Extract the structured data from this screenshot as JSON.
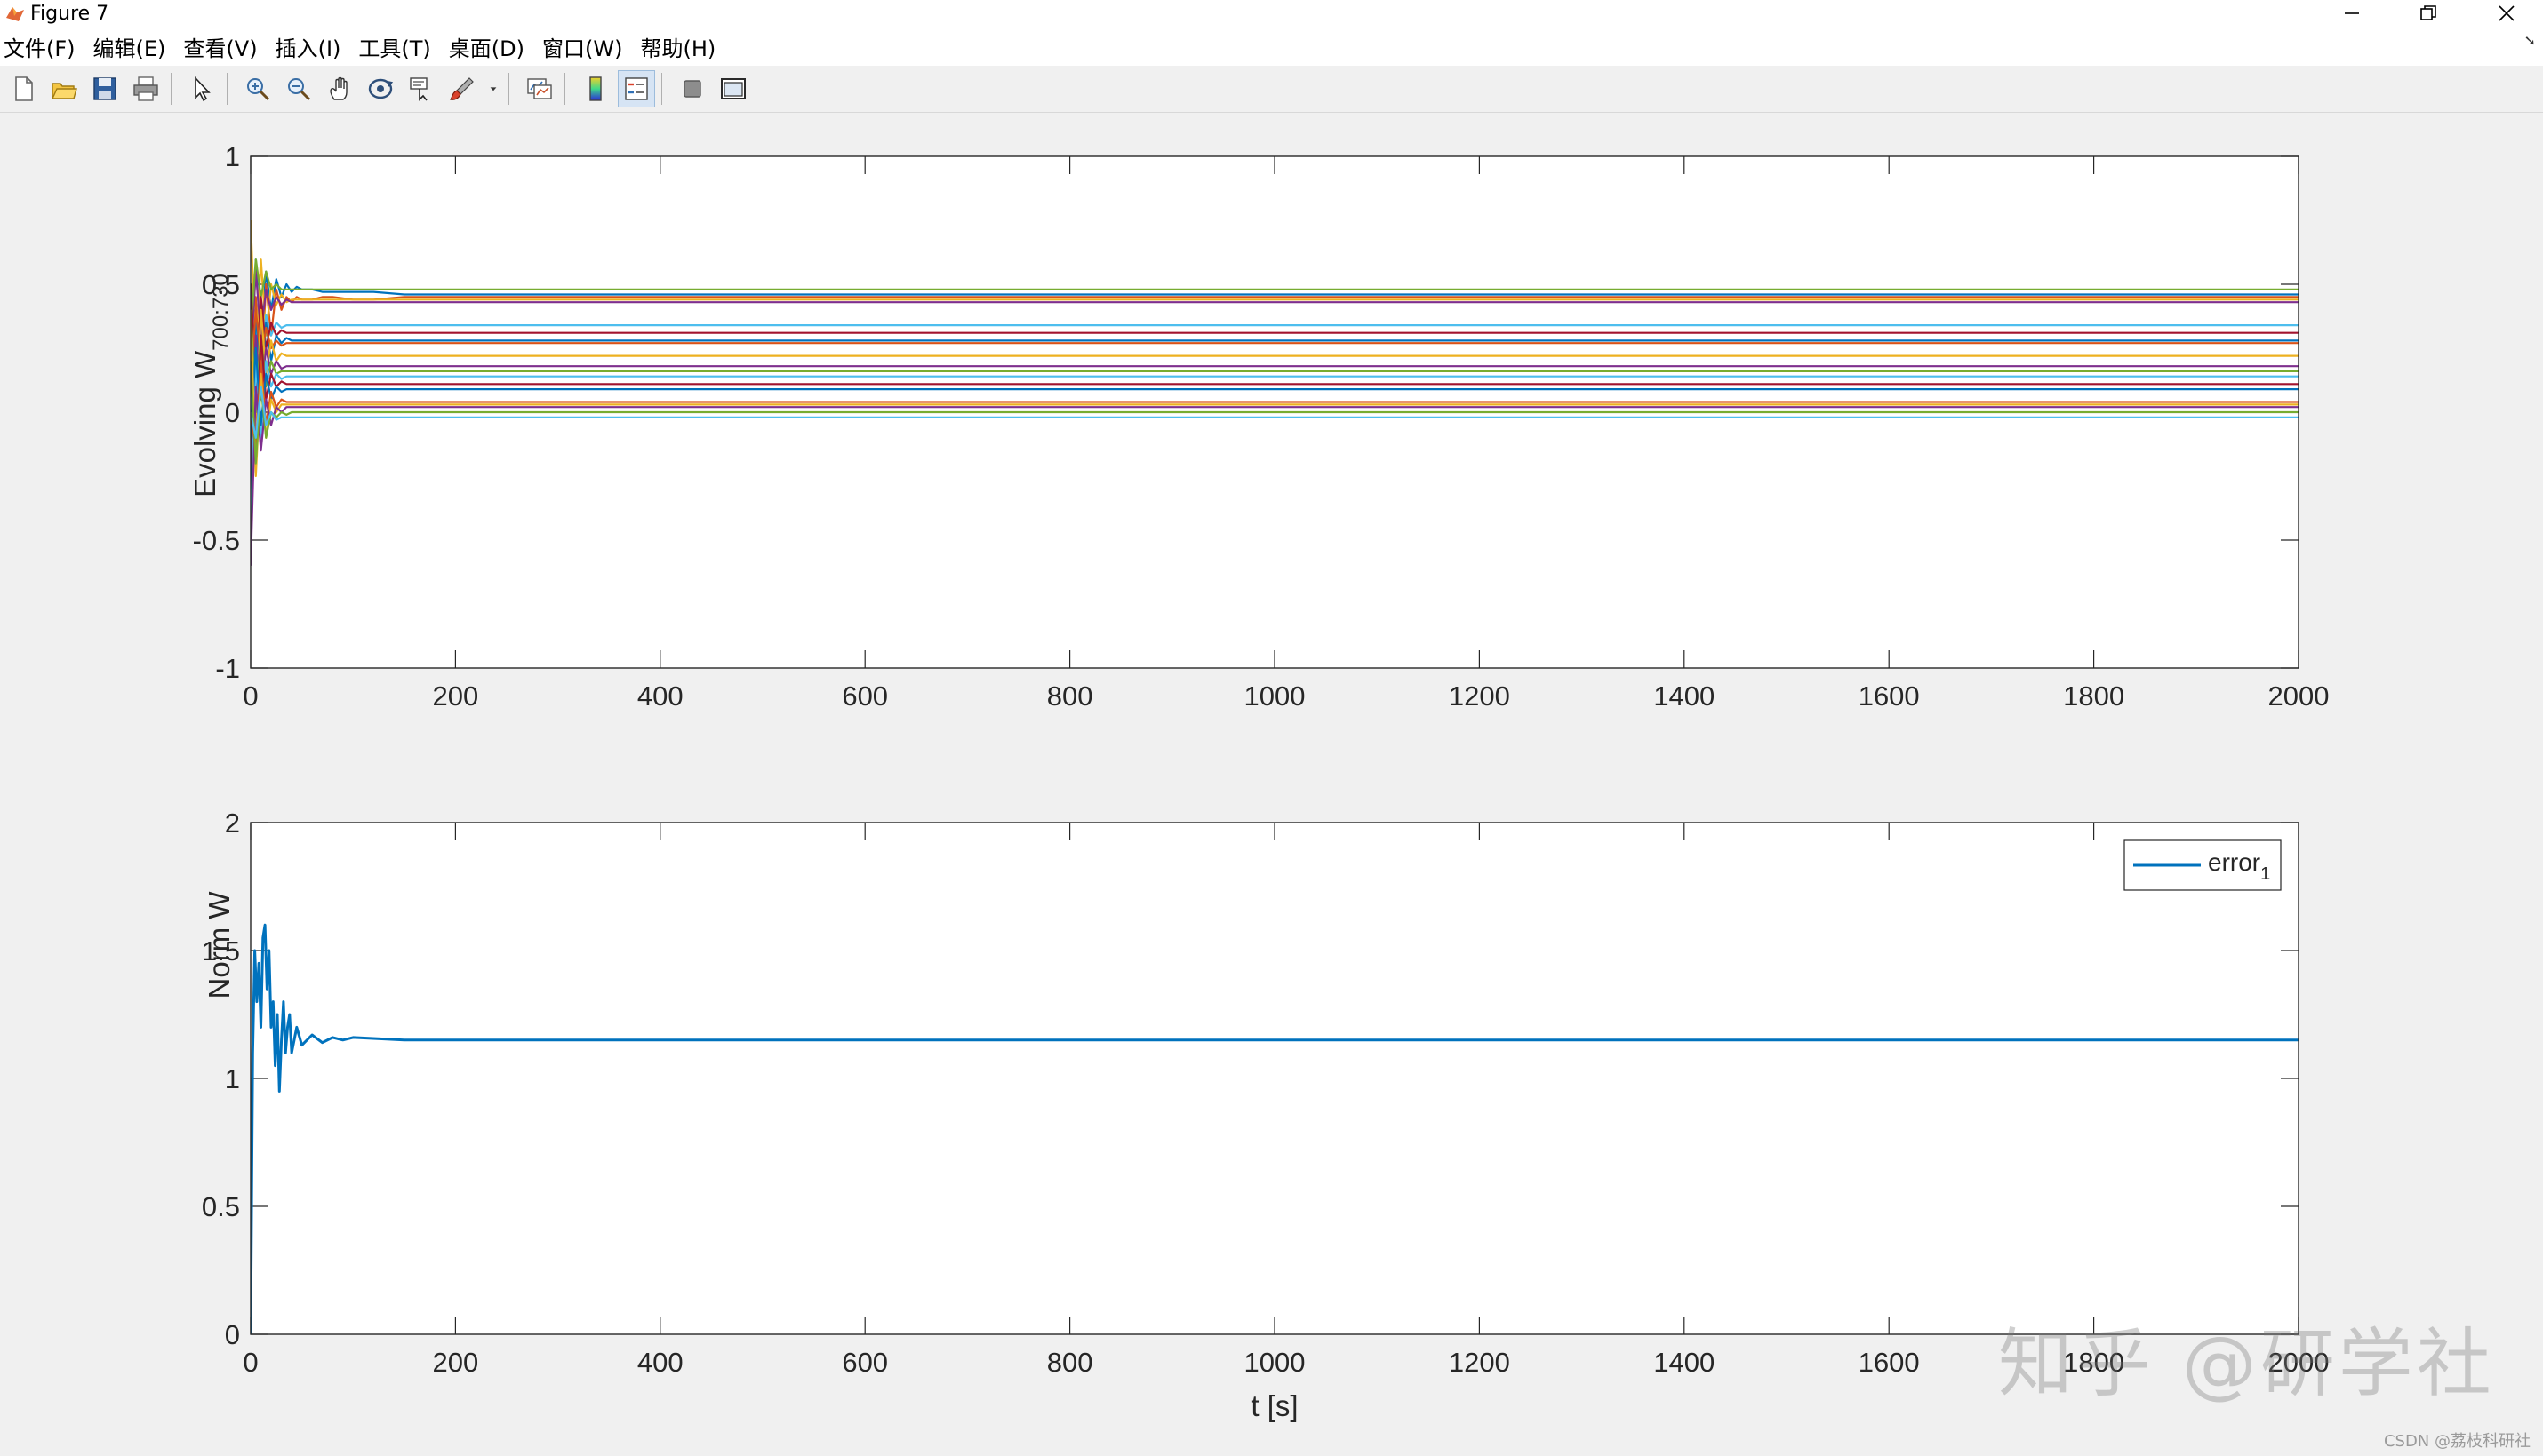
{
  "window": {
    "title": "Figure 7",
    "controls": {
      "minimize": "minimize",
      "maximize": "restore",
      "close": "close"
    }
  },
  "menu": [
    {
      "label": "文件(F)"
    },
    {
      "label": "编辑(E)"
    },
    {
      "label": "查看(V)"
    },
    {
      "label": "插入(I)"
    },
    {
      "label": "工具(T)"
    },
    {
      "label": "桌面(D)"
    },
    {
      "label": "窗口(W)"
    },
    {
      "label": "帮助(H)"
    }
  ],
  "toolbar": [
    {
      "icon": "new-figure-icon"
    },
    {
      "icon": "open-file-icon"
    },
    {
      "icon": "save-icon"
    },
    {
      "icon": "print-icon"
    },
    {
      "sep": true
    },
    {
      "icon": "pointer-icon"
    },
    {
      "sep": true
    },
    {
      "icon": "zoom-in-icon"
    },
    {
      "icon": "zoom-out-icon"
    },
    {
      "icon": "pan-icon"
    },
    {
      "icon": "rotate-3d-icon"
    },
    {
      "icon": "data-cursor-icon"
    },
    {
      "icon": "brush-icon"
    },
    {
      "icon": "dropdown-icon"
    },
    {
      "sep": true
    },
    {
      "icon": "link-plot-icon"
    },
    {
      "sep": true
    },
    {
      "icon": "colorbar-icon"
    },
    {
      "icon": "legend-icon",
      "pressed": true
    },
    {
      "sep": true
    },
    {
      "icon": "hide-plot-tools-icon"
    },
    {
      "icon": "show-plot-tools-icon"
    }
  ],
  "colors": {
    "matlab_order": [
      "#0072BD",
      "#D95319",
      "#EDB120",
      "#7E2F8E",
      "#77AC30",
      "#4DBEEE",
      "#A2142F"
    ]
  },
  "chart_data": [
    {
      "type": "line",
      "ylabel_main": "Evolving W",
      "ylabel_sub": "700:730",
      "xlabel": "",
      "xlim": [
        0,
        2000
      ],
      "ylim": [
        -1,
        1
      ],
      "xticks": [
        "0",
        "200",
        "400",
        "600",
        "800",
        "1000",
        "1200",
        "1400",
        "1600",
        "1800",
        "2000"
      ],
      "yticks": [
        "-1",
        "-0.5",
        "0",
        "0.5",
        "1"
      ],
      "x": [
        0,
        5,
        10,
        15,
        20,
        25,
        30,
        35,
        40,
        45,
        50,
        60,
        70,
        80,
        100,
        120,
        150,
        200,
        300,
        500,
        1000,
        2000
      ],
      "series": [
        {
          "values": [
            0.1,
            0.6,
            0.25,
            0.55,
            0.4,
            0.52,
            0.45,
            0.5,
            0.47,
            0.49,
            0.48,
            0.48,
            0.47,
            0.47,
            0.47,
            0.47,
            0.46,
            0.46,
            0.46,
            0.46,
            0.46,
            0.46
          ]
        },
        {
          "values": [
            -0.1,
            0.45,
            0.1,
            0.5,
            0.3,
            0.48,
            0.4,
            0.45,
            0.43,
            0.45,
            0.44,
            0.44,
            0.45,
            0.45,
            0.44,
            0.44,
            0.45,
            0.45,
            0.45,
            0.45,
            0.45,
            0.45
          ]
        },
        {
          "values": [
            0.75,
            0.2,
            0.6,
            0.3,
            0.5,
            0.42,
            0.46,
            0.43,
            0.44,
            0.44,
            0.44,
            0.44,
            0.44,
            0.44,
            0.44,
            0.44,
            0.44,
            0.44,
            0.44,
            0.44,
            0.44,
            0.44
          ]
        },
        {
          "values": [
            0.2,
            0.55,
            0.3,
            0.48,
            0.4,
            0.45,
            0.42,
            0.44,
            0.43,
            0.43,
            0.43,
            0.43,
            0.43,
            0.43,
            0.43,
            0.43,
            0.43,
            0.43,
            0.43,
            0.43,
            0.43,
            0.43
          ]
        },
        {
          "values": [
            0.3,
            0.6,
            0.45,
            0.55,
            0.48,
            0.5,
            0.48,
            0.48,
            0.48,
            0.48,
            0.48,
            0.48,
            0.48,
            0.48,
            0.48,
            0.48,
            0.48,
            0.48,
            0.48,
            0.48,
            0.48,
            0.48
          ]
        },
        {
          "values": [
            0.0,
            0.35,
            0.15,
            0.38,
            0.3,
            0.35,
            0.33,
            0.34,
            0.34,
            0.34,
            0.34,
            0.34,
            0.34,
            0.34,
            0.34,
            0.34,
            0.34,
            0.34,
            0.34,
            0.34,
            0.34,
            0.34
          ]
        },
        {
          "values": [
            0.5,
            0.1,
            0.45,
            0.25,
            0.35,
            0.3,
            0.32,
            0.31,
            0.31,
            0.31,
            0.31,
            0.31,
            0.31,
            0.31,
            0.31,
            0.31,
            0.31,
            0.31,
            0.31,
            0.31,
            0.31,
            0.31
          ]
        },
        {
          "values": [
            -0.3,
            0.4,
            0.1,
            0.35,
            0.2,
            0.3,
            0.27,
            0.29,
            0.28,
            0.28,
            0.28,
            0.28,
            0.28,
            0.28,
            0.28,
            0.28,
            0.28,
            0.28,
            0.28,
            0.28,
            0.28,
            0.28
          ]
        },
        {
          "values": [
            0.1,
            0.4,
            0.2,
            0.33,
            0.25,
            0.28,
            0.26,
            0.27,
            0.27,
            0.27,
            0.27,
            0.27,
            0.27,
            0.27,
            0.27,
            0.27,
            0.27,
            0.27,
            0.27,
            0.27,
            0.27,
            0.27
          ]
        },
        {
          "values": [
            0.3,
            -0.1,
            0.4,
            0.15,
            0.28,
            0.2,
            0.23,
            0.22,
            0.22,
            0.22,
            0.22,
            0.22,
            0.22,
            0.22,
            0.22,
            0.22,
            0.22,
            0.22,
            0.22,
            0.22,
            0.22,
            0.22
          ]
        },
        {
          "values": [
            -0.2,
            0.3,
            0.05,
            0.25,
            0.15,
            0.2,
            0.17,
            0.18,
            0.18,
            0.18,
            0.18,
            0.18,
            0.18,
            0.18,
            0.18,
            0.18,
            0.18,
            0.18,
            0.18,
            0.18,
            0.18,
            0.18
          ]
        },
        {
          "values": [
            0.4,
            0.0,
            0.3,
            0.1,
            0.2,
            0.15,
            0.16,
            0.16,
            0.16,
            0.16,
            0.16,
            0.16,
            0.16,
            0.16,
            0.16,
            0.16,
            0.16,
            0.16,
            0.16,
            0.16,
            0.16,
            0.16
          ]
        },
        {
          "values": [
            -0.5,
            0.2,
            -0.1,
            0.2,
            0.1,
            0.15,
            0.13,
            0.14,
            0.14,
            0.14,
            0.14,
            0.14,
            0.14,
            0.14,
            0.14,
            0.14,
            0.14,
            0.14,
            0.14,
            0.14,
            0.14,
            0.14
          ]
        },
        {
          "values": [
            0.2,
            -0.2,
            0.3,
            0.05,
            0.15,
            0.1,
            0.12,
            0.11,
            0.11,
            0.11,
            0.11,
            0.11,
            0.11,
            0.11,
            0.11,
            0.11,
            0.11,
            0.11,
            0.11,
            0.11,
            0.11,
            0.11
          ]
        },
        {
          "values": [
            -0.1,
            0.25,
            -0.05,
            0.15,
            0.05,
            0.1,
            0.08,
            0.09,
            0.09,
            0.09,
            0.09,
            0.09,
            0.09,
            0.09,
            0.09,
            0.09,
            0.09,
            0.09,
            0.09,
            0.09,
            0.09,
            0.09
          ]
        },
        {
          "values": [
            0.0,
            -0.15,
            0.2,
            -0.05,
            0.08,
            0.02,
            0.05,
            0.04,
            0.04,
            0.04,
            0.04,
            0.04,
            0.04,
            0.04,
            0.04,
            0.04,
            0.04,
            0.04,
            0.04,
            0.04,
            0.04,
            0.04
          ]
        },
        {
          "values": [
            0.4,
            -0.25,
            0.15,
            -0.1,
            0.05,
            0.0,
            0.03,
            0.03,
            0.03,
            0.03,
            0.03,
            0.03,
            0.03,
            0.03,
            0.03,
            0.03,
            0.03,
            0.03,
            0.03,
            0.03,
            0.03,
            0.03
          ]
        },
        {
          "values": [
            -0.6,
            0.1,
            -0.15,
            0.05,
            -0.05,
            0.02,
            0.0,
            0.02,
            0.02,
            0.02,
            0.02,
            0.02,
            0.02,
            0.02,
            0.02,
            0.02,
            0.02,
            0.02,
            0.02,
            0.02,
            0.02,
            0.02
          ]
        },
        {
          "values": [
            0.2,
            -0.2,
            0.1,
            -0.1,
            0.0,
            -0.02,
            0.0,
            -0.01,
            0.0,
            0.0,
            0.0,
            0.0,
            0.0,
            0.0,
            0.0,
            0.0,
            0.0,
            0.0,
            0.0,
            0.0,
            0.0,
            0.0
          ]
        },
        {
          "values": [
            0.0,
            -0.1,
            0.1,
            -0.05,
            0.0,
            -0.03,
            -0.02,
            -0.02,
            -0.02,
            -0.02,
            -0.02,
            -0.02,
            -0.02,
            -0.02,
            -0.02,
            -0.02,
            -0.02,
            -0.02,
            -0.02,
            -0.02,
            -0.02,
            -0.02
          ]
        }
      ]
    },
    {
      "type": "line",
      "ylabel": "Norm W",
      "xlabel": "t [s]",
      "xlim": [
        0,
        2000
      ],
      "ylim": [
        0,
        2
      ],
      "xticks": [
        "0",
        "200",
        "400",
        "600",
        "800",
        "1000",
        "1200",
        "1400",
        "1600",
        "1800",
        "2000"
      ],
      "yticks": [
        "0",
        "0.5",
        "1",
        "1.5",
        "2"
      ],
      "legend": {
        "location": "top-right"
      },
      "x": [
        0,
        2,
        4,
        6,
        8,
        10,
        12,
        14,
        16,
        18,
        20,
        22,
        24,
        26,
        28,
        30,
        32,
        34,
        36,
        38,
        40,
        45,
        50,
        60,
        70,
        80,
        90,
        100,
        150,
        200,
        500,
        2000
      ],
      "series": [
        {
          "name_main": "error",
          "name_sub": "1",
          "values": [
            0.0,
            1.1,
            1.5,
            1.3,
            1.45,
            1.2,
            1.55,
            1.6,
            1.35,
            1.5,
            1.2,
            1.3,
            1.05,
            1.25,
            0.95,
            1.15,
            1.3,
            1.1,
            1.2,
            1.25,
            1.1,
            1.2,
            1.13,
            1.17,
            1.14,
            1.16,
            1.15,
            1.16,
            1.15,
            1.15,
            1.15,
            1.15
          ]
        }
      ]
    }
  ],
  "watermark": {
    "text": "知乎 @研学社"
  },
  "credit": {
    "text": "CSDN @荔枝科研社"
  }
}
